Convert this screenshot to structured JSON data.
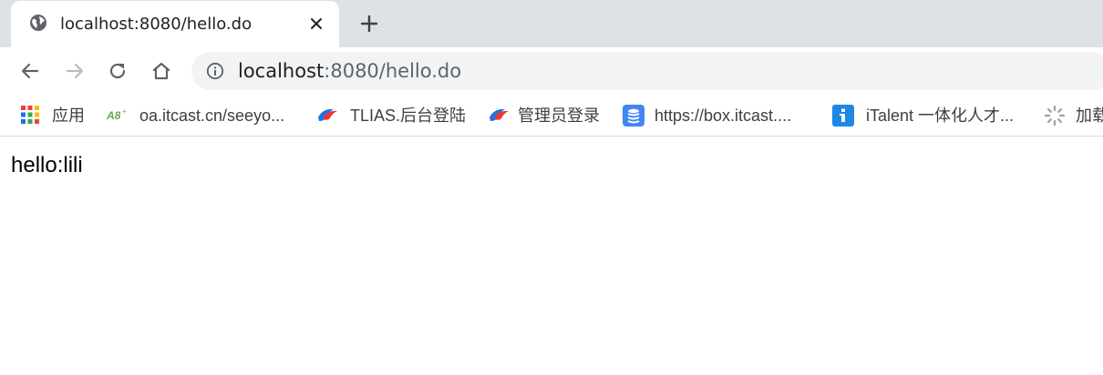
{
  "tab": {
    "title": "localhost:8080/hello.do"
  },
  "omnibox": {
    "host": "localhost",
    "rest": ":8080/hello.do"
  },
  "bookmarks": [
    {
      "label": "应用",
      "icon": "apps-grid-icon"
    },
    {
      "label": "oa.itcast.cn/seeyo...",
      "icon": "a8-logo-icon"
    },
    {
      "label": "TLIAS.后台登陆",
      "icon": "tlias-logo-icon"
    },
    {
      "label": "管理员登录",
      "icon": "tlias-logo-icon"
    },
    {
      "label": "https://box.itcast....",
      "icon": "database-icon"
    },
    {
      "label": "iTalent 一体化人才...",
      "icon": "info-icon"
    },
    {
      "label": "加载",
      "icon": "loading-spinner-icon"
    }
  ],
  "page": {
    "text": "hello:lili"
  },
  "colors": {
    "tabstrip": "#dee1e6",
    "omnibox": "#f1f3f4",
    "blue_icon": "#1a73e8"
  }
}
